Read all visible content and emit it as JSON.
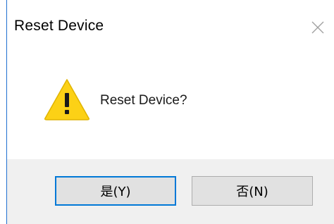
{
  "dialog": {
    "title": "Reset Device",
    "message": "Reset Device?",
    "icon": "warning-triangle-icon",
    "close_icon": "close-icon"
  },
  "buttons": {
    "yes_label": "是(Y)",
    "no_label": "否(N)"
  },
  "colors": {
    "accent": "#0078d7",
    "warning_fill": "#fcd116",
    "footer_bg": "#f0f0f0",
    "button_bg": "#e1e1e1"
  }
}
